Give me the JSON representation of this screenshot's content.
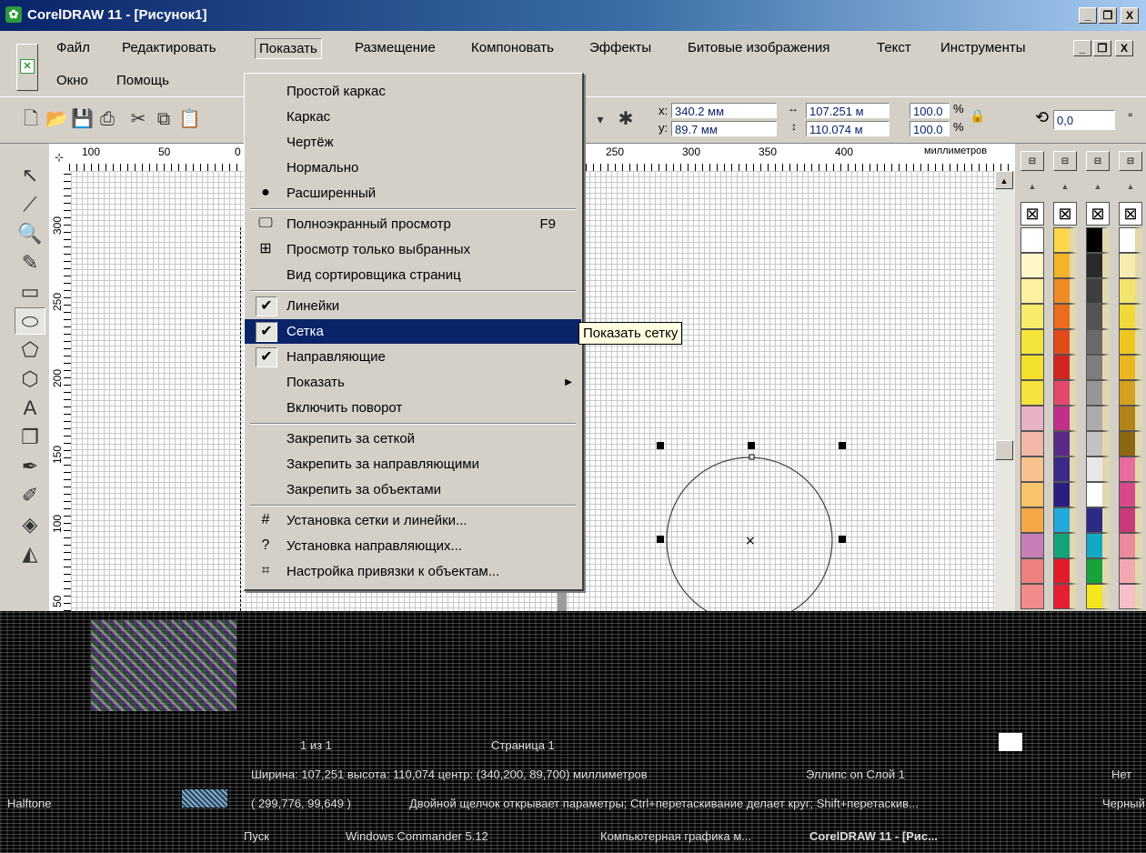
{
  "window": {
    "title": "CorelDRAW 11 - [Рисунок1]",
    "controls": [
      "_",
      "❐",
      "X"
    ]
  },
  "menubar": {
    "row1": [
      "Файл",
      "Редактировать",
      "Показать",
      "Размещение",
      "Компоновать",
      "Эффекты",
      "Битовые изображения",
      "Текст",
      "Инструменты"
    ],
    "row2": [
      "Окно",
      "Помощь"
    ],
    "active": "Показать"
  },
  "toolbar": {
    "x_label": "x:",
    "x_value": "340.2 мм",
    "y_label": "y:",
    "y_value": "89.7 мм",
    "w_value": "107.251 м",
    "h_value": "110.074 м",
    "scale_x": "100.0",
    "scale_y": "100.0",
    "pct": "%",
    "rotate_value": "0,0",
    "degree": "°"
  },
  "ruler": {
    "h_labels": [
      "100",
      "50",
      "0",
      "250",
      "300",
      "350",
      "400"
    ],
    "units": "миллиметров",
    "v_labels": [
      "300",
      "250",
      "200",
      "150",
      "100",
      "50"
    ]
  },
  "view_menu": {
    "items": [
      {
        "label": "Простой каркас",
        "accel": "",
        "mark": ""
      },
      {
        "label": "Каркас",
        "accel": "",
        "mark": ""
      },
      {
        "label": "Чертёж",
        "accel": "",
        "mark": ""
      },
      {
        "label": "Нормально",
        "accel": "",
        "mark": ""
      },
      {
        "label": "Расширенный",
        "accel": "",
        "mark": "radio"
      },
      {
        "label": "Полноэкранный просмотр",
        "accel": "F9",
        "mark": "monitor-icon"
      },
      {
        "label": "Просмотр только выбранных",
        "accel": "",
        "mark": "selected-view-icon"
      },
      {
        "label": "Вид сортировщика страниц",
        "accel": "",
        "mark": ""
      },
      {
        "label": "Линейки",
        "accel": "",
        "mark": "check"
      },
      {
        "label": "Сетка",
        "accel": "",
        "mark": "check"
      },
      {
        "label": "Направляющие",
        "accel": "",
        "mark": "check"
      },
      {
        "label": "Показать",
        "accel": "▶",
        "mark": ""
      },
      {
        "label": "Включить поворот",
        "accel": "",
        "mark": ""
      },
      {
        "label": "Закрепить за сеткой",
        "accel": "",
        "mark": ""
      },
      {
        "label": "Закрепить за направляющими",
        "accel": "",
        "mark": ""
      },
      {
        "label": "Закрепить за объектами",
        "accel": "",
        "mark": ""
      },
      {
        "label": "Установка сетки и линейки...",
        "accel": "",
        "mark": "grid-setup-icon"
      },
      {
        "label": "Установка направляющих...",
        "accel": "",
        "mark": "guides-setup-icon"
      },
      {
        "label": "Настройка привязки к объектам...",
        "accel": "",
        "mark": "snap-setup-icon"
      }
    ],
    "highlighted": "Сетка"
  },
  "tooltip": "Показать сетку",
  "statusbar": {
    "page_nav": "1 из 1",
    "page_tab": "Страница 1",
    "dims_text": "Ширина: 107,251  высота: 110,074  центр: (340,200, 89,700)  миллиметров",
    "layer_text": "Эллипс on Слой 1",
    "coords_text": "( 299,776, 99,649 )",
    "hint_text": "Двойной щелчок открывает параметры; Ctrl+перетаскивание делает круг; Shift+перетаскив...",
    "fill_label": "Нет",
    "fill_name": "Halftone",
    "outline_label": "Черный"
  },
  "taskbar": {
    "tasks": [
      "Пуск",
      "Windows Commander 5.12",
      "Компьютерная графика м...",
      "CorelDRAW 11 - [Рис..."
    ]
  },
  "colors": {
    "title_start": "#0a246a",
    "title_end": "#a6caf0",
    "menu_highlight": "#0a246a",
    "tooltip_bg": "#ffffe1"
  }
}
